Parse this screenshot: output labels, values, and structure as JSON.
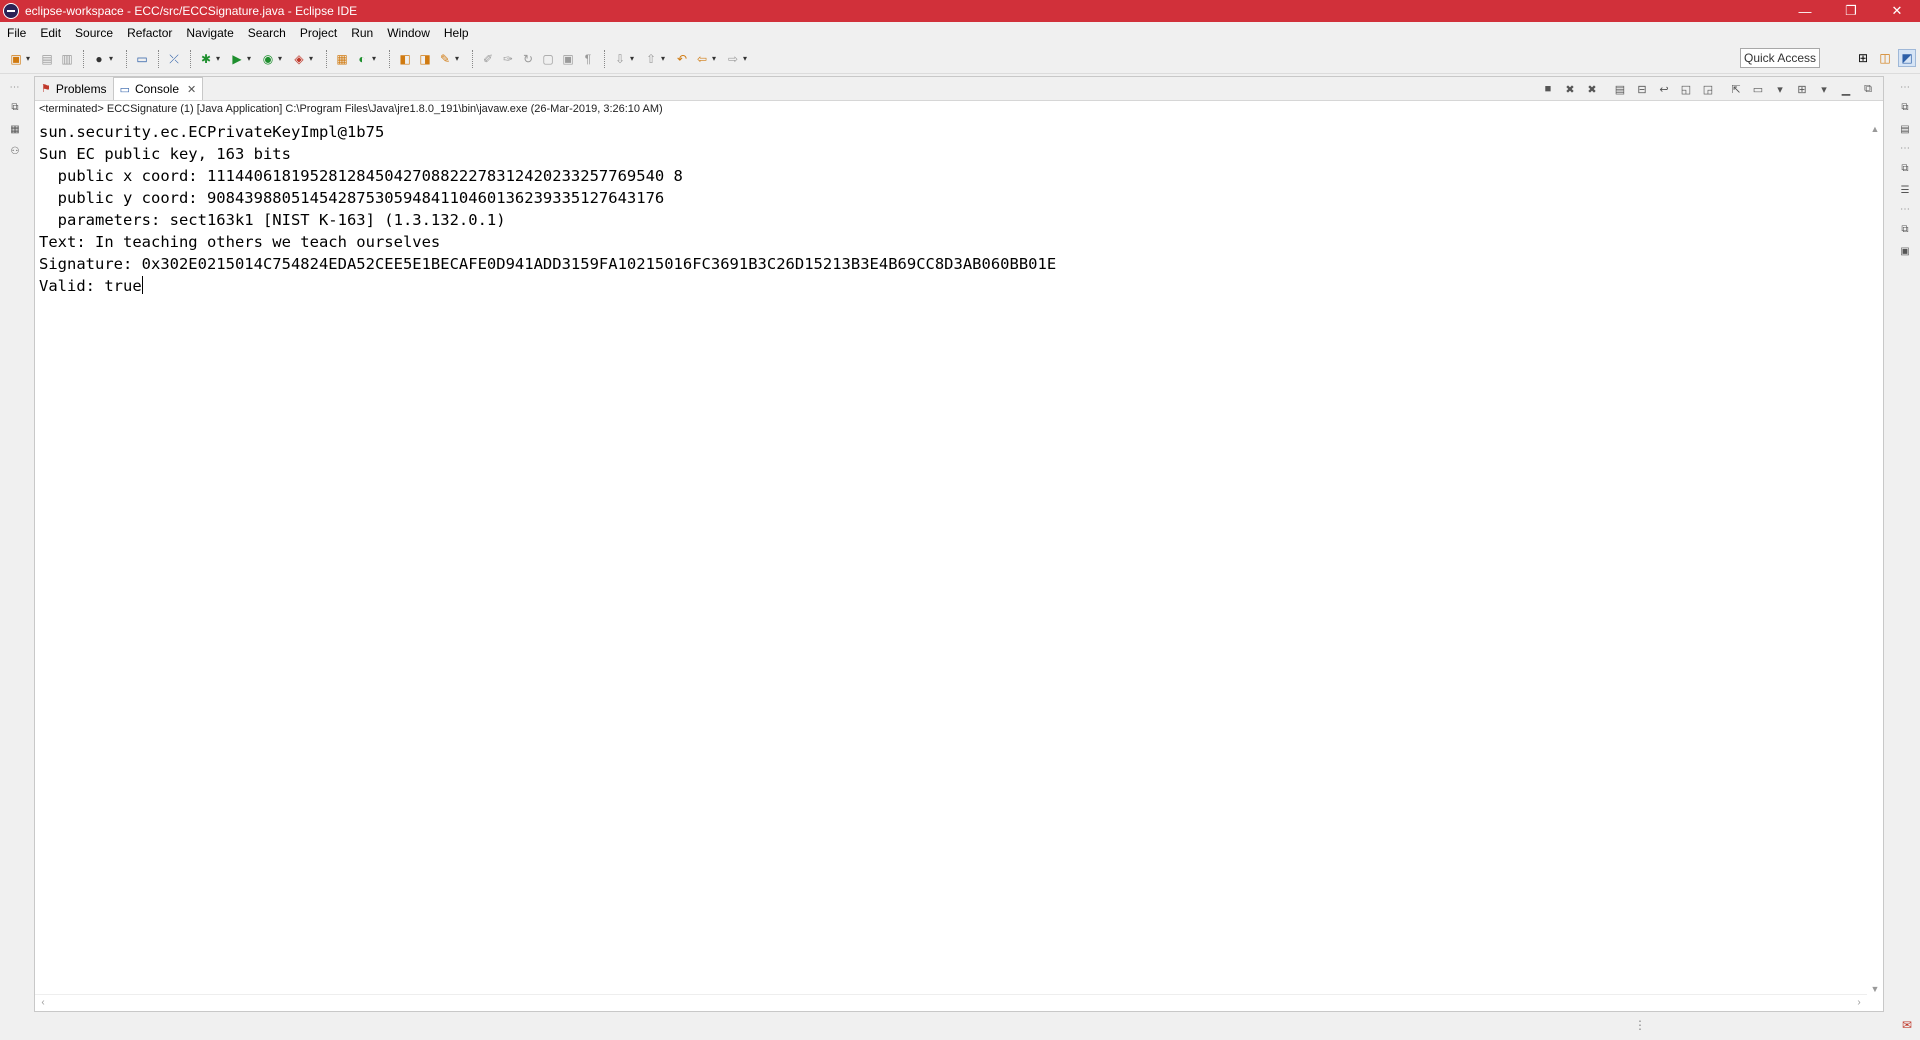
{
  "window": {
    "title": "eclipse-workspace - ECC/src/ECCSignature.java - Eclipse IDE",
    "controls": {
      "minimize": "—",
      "restore": "❐",
      "close": "✕"
    }
  },
  "menu": [
    "File",
    "Edit",
    "Source",
    "Refactor",
    "Navigate",
    "Search",
    "Project",
    "Run",
    "Window",
    "Help"
  ],
  "toolbar": {
    "quick_access": "Quick Access"
  },
  "views": {
    "tabs": [
      {
        "label": "Problems",
        "icon": "problems-icon",
        "active": false
      },
      {
        "label": "Console",
        "icon": "console-icon",
        "active": true
      }
    ]
  },
  "console": {
    "process_label": "<terminated> ECCSignature (1) [Java Application] C:\\Program Files\\Java\\jre1.8.0_191\\bin\\javaw.exe (26-Mar-2019, 3:26:10 AM)",
    "lines": [
      "sun.security.ec.ECPrivateKeyImpl@1b75",
      "Sun EC public key, 163 bits",
      "  public x coord: 1114406181952812845042708822278312420233257769540 8",
      "  public y coord: 9084398805145428753059484110460136239335127643176",
      "  parameters: sect163k1 [NIST K-163] (1.3.132.0.1)",
      "Text: In teaching others we teach ourselves",
      "Signature: 0x302E0215014C754824EDA52CEE5E1BECAFE0D941ADD3159FA10215016FC3691B3C26D15213B3E4B69CC8D3AB060BB01E",
      "Valid: true"
    ]
  }
}
